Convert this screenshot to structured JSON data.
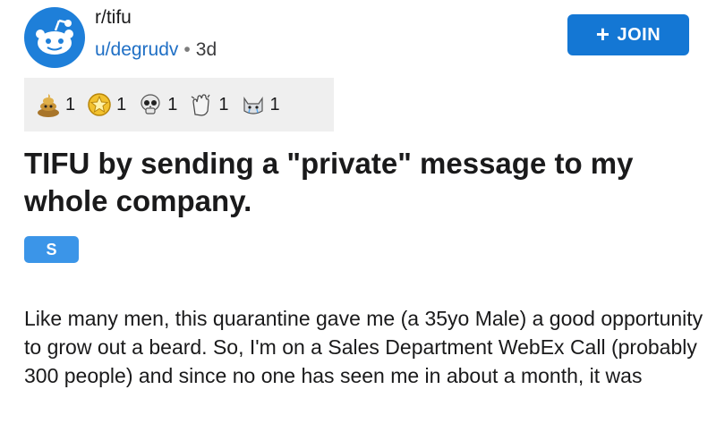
{
  "post": {
    "subreddit": "r/tifu",
    "author": "u/degrudv",
    "separator": "•",
    "age": "3d",
    "join_label": "JOIN",
    "join_icon": "plus-icon",
    "awards": [
      {
        "icon": "poop-award-icon",
        "count": "1"
      },
      {
        "icon": "gold-star-award-icon",
        "count": "1"
      },
      {
        "icon": "skull-award-icon",
        "count": "1"
      },
      {
        "icon": "clapping-hands-award-icon",
        "count": "1"
      },
      {
        "icon": "crying-cat-award-icon",
        "count": "1"
      }
    ],
    "title": "TIFU by sending a \"private\" message to my whole company.",
    "flair": "S",
    "body": "Like many men, this quarantine gave me (a 35yo Male) a good opportunity to grow out a beard.  So, I'm on a Sales Department WebEx Call (probably 300 people) and since no one has seen me in about a month, it was"
  },
  "colors": {
    "accent": "#1477d4",
    "subreddit_icon_bg": "#1e7fd9",
    "username": "#1f6fc5",
    "flair_bg": "#3b95e8",
    "awards_bg": "#efefef"
  }
}
